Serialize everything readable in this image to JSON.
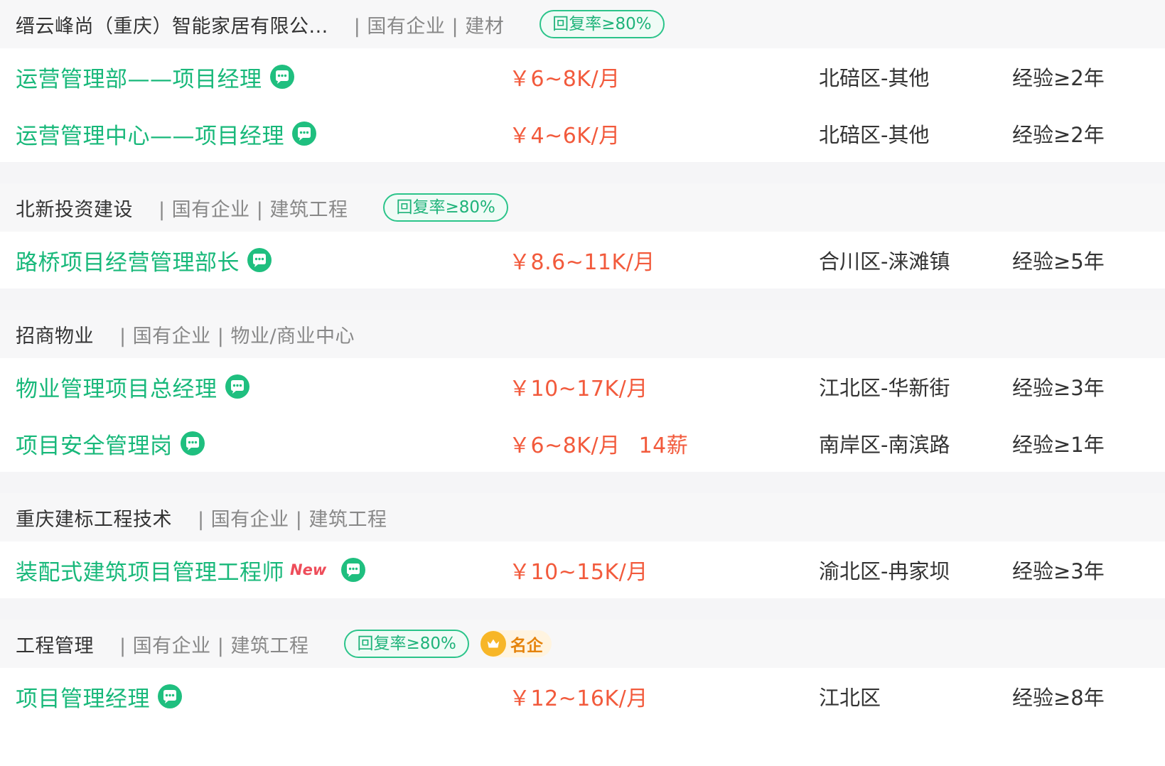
{
  "companies": [
    {
      "name": "缙云峰尚（重庆）智能家居有限公...",
      "tags": "| 国有企业 | 建材",
      "reply_badge": "回复率≥80%",
      "famous_badge": "",
      "jobs": [
        {
          "title": "运营管理部——项目经理",
          "new": "",
          "salary": "￥6~8K/月",
          "bonus": "",
          "location": "北碚区-其他",
          "experience": "经验≥2年"
        },
        {
          "title": "运营管理中心——项目经理",
          "new": "",
          "salary": "￥4~6K/月",
          "bonus": "",
          "location": "北碚区-其他",
          "experience": "经验≥2年"
        }
      ]
    },
    {
      "name": "北新投资建设",
      "tags": "| 国有企业 | 建筑工程",
      "reply_badge": "回复率≥80%",
      "famous_badge": "",
      "jobs": [
        {
          "title": "路桥项目经营管理部长",
          "new": "",
          "salary": "￥8.6~11K/月",
          "bonus": "",
          "location": "合川区-涞滩镇",
          "experience": "经验≥5年"
        }
      ]
    },
    {
      "name": "招商物业",
      "tags": "| 国有企业 | 物业/商业中心",
      "reply_badge": "",
      "famous_badge": "",
      "jobs": [
        {
          "title": "物业管理项目总经理",
          "new": "",
          "salary": "￥10~17K/月",
          "bonus": "",
          "location": "江北区-华新街",
          "experience": "经验≥3年"
        },
        {
          "title": "项目安全管理岗",
          "new": "",
          "salary": "￥6~8K/月",
          "bonus": "14薪",
          "location": "南岸区-南滨路",
          "experience": "经验≥1年"
        }
      ]
    },
    {
      "name": "重庆建标工程技术",
      "tags": "| 国有企业 | 建筑工程",
      "reply_badge": "",
      "famous_badge": "",
      "jobs": [
        {
          "title": "装配式建筑项目管理工程师",
          "new": "New",
          "salary": "￥10~15K/月",
          "bonus": "",
          "location": "渝北区-冉家坝",
          "experience": "经验≥3年"
        }
      ]
    },
    {
      "name": "工程管理",
      "tags": "| 国有企业 | 建筑工程",
      "reply_badge": "回复率≥80%",
      "famous_badge": "名企",
      "jobs": [
        {
          "title": "项目管理经理",
          "new": "",
          "salary": "￥12~16K/月",
          "bonus": "",
          "location": "江北区",
          "experience": "经验≥8年"
        }
      ]
    }
  ],
  "colors": {
    "title_green": "#18b87a",
    "salary_red": "#f25a3c",
    "badge_green": "#2bc48a",
    "famous_orange": "#e5830b"
  },
  "icons": {
    "chat": "chat-bubble-icon",
    "crown": "crown-icon"
  }
}
